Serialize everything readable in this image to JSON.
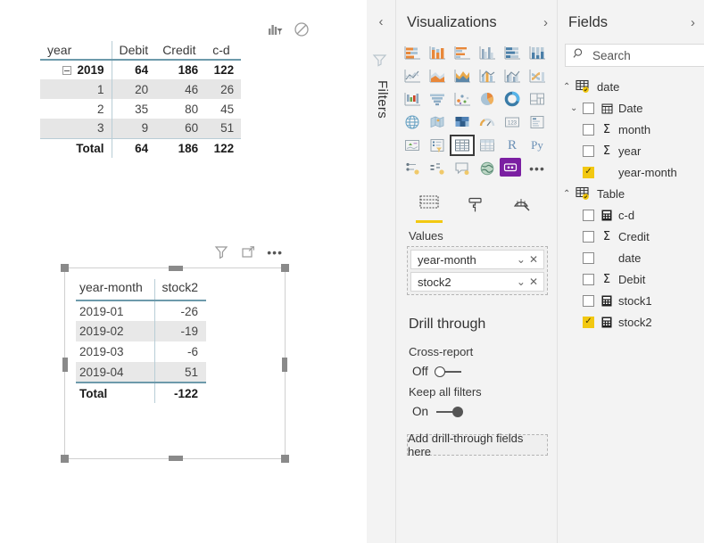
{
  "canvas": {
    "visual1": {
      "name": "matrix-visual",
      "header_icons": [
        "filter-applied-icon",
        "blocked-icon"
      ],
      "columns": [
        "year",
        "Debit",
        "Credit",
        "c-d"
      ],
      "rows": [
        {
          "label": "2019",
          "expandable": true,
          "expanded": true,
          "bold": true,
          "values": [
            "64",
            "186",
            "122"
          ]
        },
        {
          "label": "1",
          "expandable": false,
          "bold": false,
          "values": [
            "20",
            "46",
            "26"
          ]
        },
        {
          "label": "2",
          "expandable": false,
          "bold": false,
          "values": [
            "35",
            "80",
            "45"
          ]
        },
        {
          "label": "3",
          "expandable": false,
          "bold": false,
          "values": [
            "9",
            "60",
            "51"
          ]
        }
      ],
      "total": {
        "label": "Total",
        "values": [
          "64",
          "186",
          "122"
        ]
      }
    },
    "visual2": {
      "name": "table-visual",
      "selected": true,
      "header_icons": [
        "filter-icon",
        "focus-mode-icon",
        "more-options-icon"
      ],
      "columns": [
        "year-month",
        "stock2"
      ],
      "rows": [
        {
          "label": "2019-01",
          "value": "-26"
        },
        {
          "label": "2019-02",
          "value": "-19"
        },
        {
          "label": "2019-03",
          "value": "-6"
        },
        {
          "label": "2019-04",
          "value": "51"
        }
      ],
      "total": {
        "label": "Total",
        "value": "-122"
      }
    }
  },
  "filters_rail": {
    "collapse_label": "‹",
    "icon": "funnel-icon",
    "title": "Filters"
  },
  "visualizations": {
    "title": "Visualizations",
    "expand_chevron": "›",
    "icons": [
      "stacked-bar-chart-icon",
      "stacked-column-chart-icon",
      "clustered-bar-chart-icon",
      "clustered-column-chart-icon",
      "100-stacked-bar-chart-icon",
      "100-stacked-column-chart-icon",
      "line-chart-icon",
      "area-chart-icon",
      "stacked-area-chart-icon",
      "line-stacked-column-chart-icon",
      "line-clustered-column-chart-icon",
      "ribbon-chart-icon",
      "waterfall-chart-icon",
      "funnel-chart-icon",
      "scatter-chart-icon",
      "pie-chart-icon",
      "donut-chart-icon",
      "treemap-icon",
      "map-icon",
      "filled-map-icon",
      "shape-map-icon",
      "gauge-icon",
      "card-icon",
      "multi-row-card-icon",
      "kpi-icon",
      "slicer-icon",
      "table-icon",
      "matrix-icon",
      "r-script-visual-icon",
      "python-visual-icon",
      "key-influencers-icon",
      "decomposition-tree-icon",
      "qna-icon",
      "arcgis-map-icon",
      "custom-visual-icon",
      "more-visuals-icon"
    ],
    "selected_icon": "table-icon",
    "tabs": [
      {
        "name": "fields-tab",
        "icon": "fields-icon",
        "active": true
      },
      {
        "name": "format-tab",
        "icon": "paint-roller-icon",
        "active": false
      },
      {
        "name": "analytics-tab",
        "icon": "analytics-magnifier-icon",
        "active": false
      }
    ],
    "values_well": {
      "label": "Values",
      "pills": [
        "year-month",
        "stock2"
      ]
    },
    "drill_through": {
      "title": "Drill through",
      "cross_report": {
        "label": "Cross-report",
        "state": "Off",
        "on": false
      },
      "keep_all_filters": {
        "label": "Keep all filters",
        "state": "On",
        "on": true
      },
      "drop_zone": "Add drill-through fields here"
    }
  },
  "fields": {
    "title": "Fields",
    "expand_chevron": "›",
    "search": {
      "placeholder": "Search",
      "value": "",
      "icon": "search-icon"
    },
    "tables": [
      {
        "name": "date",
        "expanded": true,
        "checked_badge": true,
        "fields": [
          {
            "name": "Date",
            "icon": "calendar-icon",
            "checked": false,
            "has_chevron": true
          },
          {
            "name": "month",
            "icon": "sigma-icon",
            "checked": false,
            "has_chevron": false
          },
          {
            "name": "year",
            "icon": "sigma-icon",
            "checked": false,
            "has_chevron": false
          },
          {
            "name": "year-month",
            "icon": "none",
            "checked": true,
            "has_chevron": false
          }
        ]
      },
      {
        "name": "Table",
        "expanded": true,
        "checked_badge": true,
        "fields": [
          {
            "name": "c-d",
            "icon": "measure-icon",
            "checked": false,
            "has_chevron": false
          },
          {
            "name": "Credit",
            "icon": "sigma-icon",
            "checked": false,
            "has_chevron": false
          },
          {
            "name": "date",
            "icon": "none",
            "checked": false,
            "has_chevron": false
          },
          {
            "name": "Debit",
            "icon": "sigma-icon",
            "checked": false,
            "has_chevron": false
          },
          {
            "name": "stock1",
            "icon": "measure-icon",
            "checked": false,
            "has_chevron": false
          },
          {
            "name": "stock2",
            "icon": "measure-icon",
            "checked": true,
            "has_chevron": false
          }
        ]
      }
    ]
  },
  "colors": {
    "accent_yellow": "#f2c811",
    "panel_background": "#f3f3f3",
    "table_rule": "#6d9aab",
    "custom_visual_purple": "#7b1fa2",
    "row_alt": "#e6e6e6"
  }
}
